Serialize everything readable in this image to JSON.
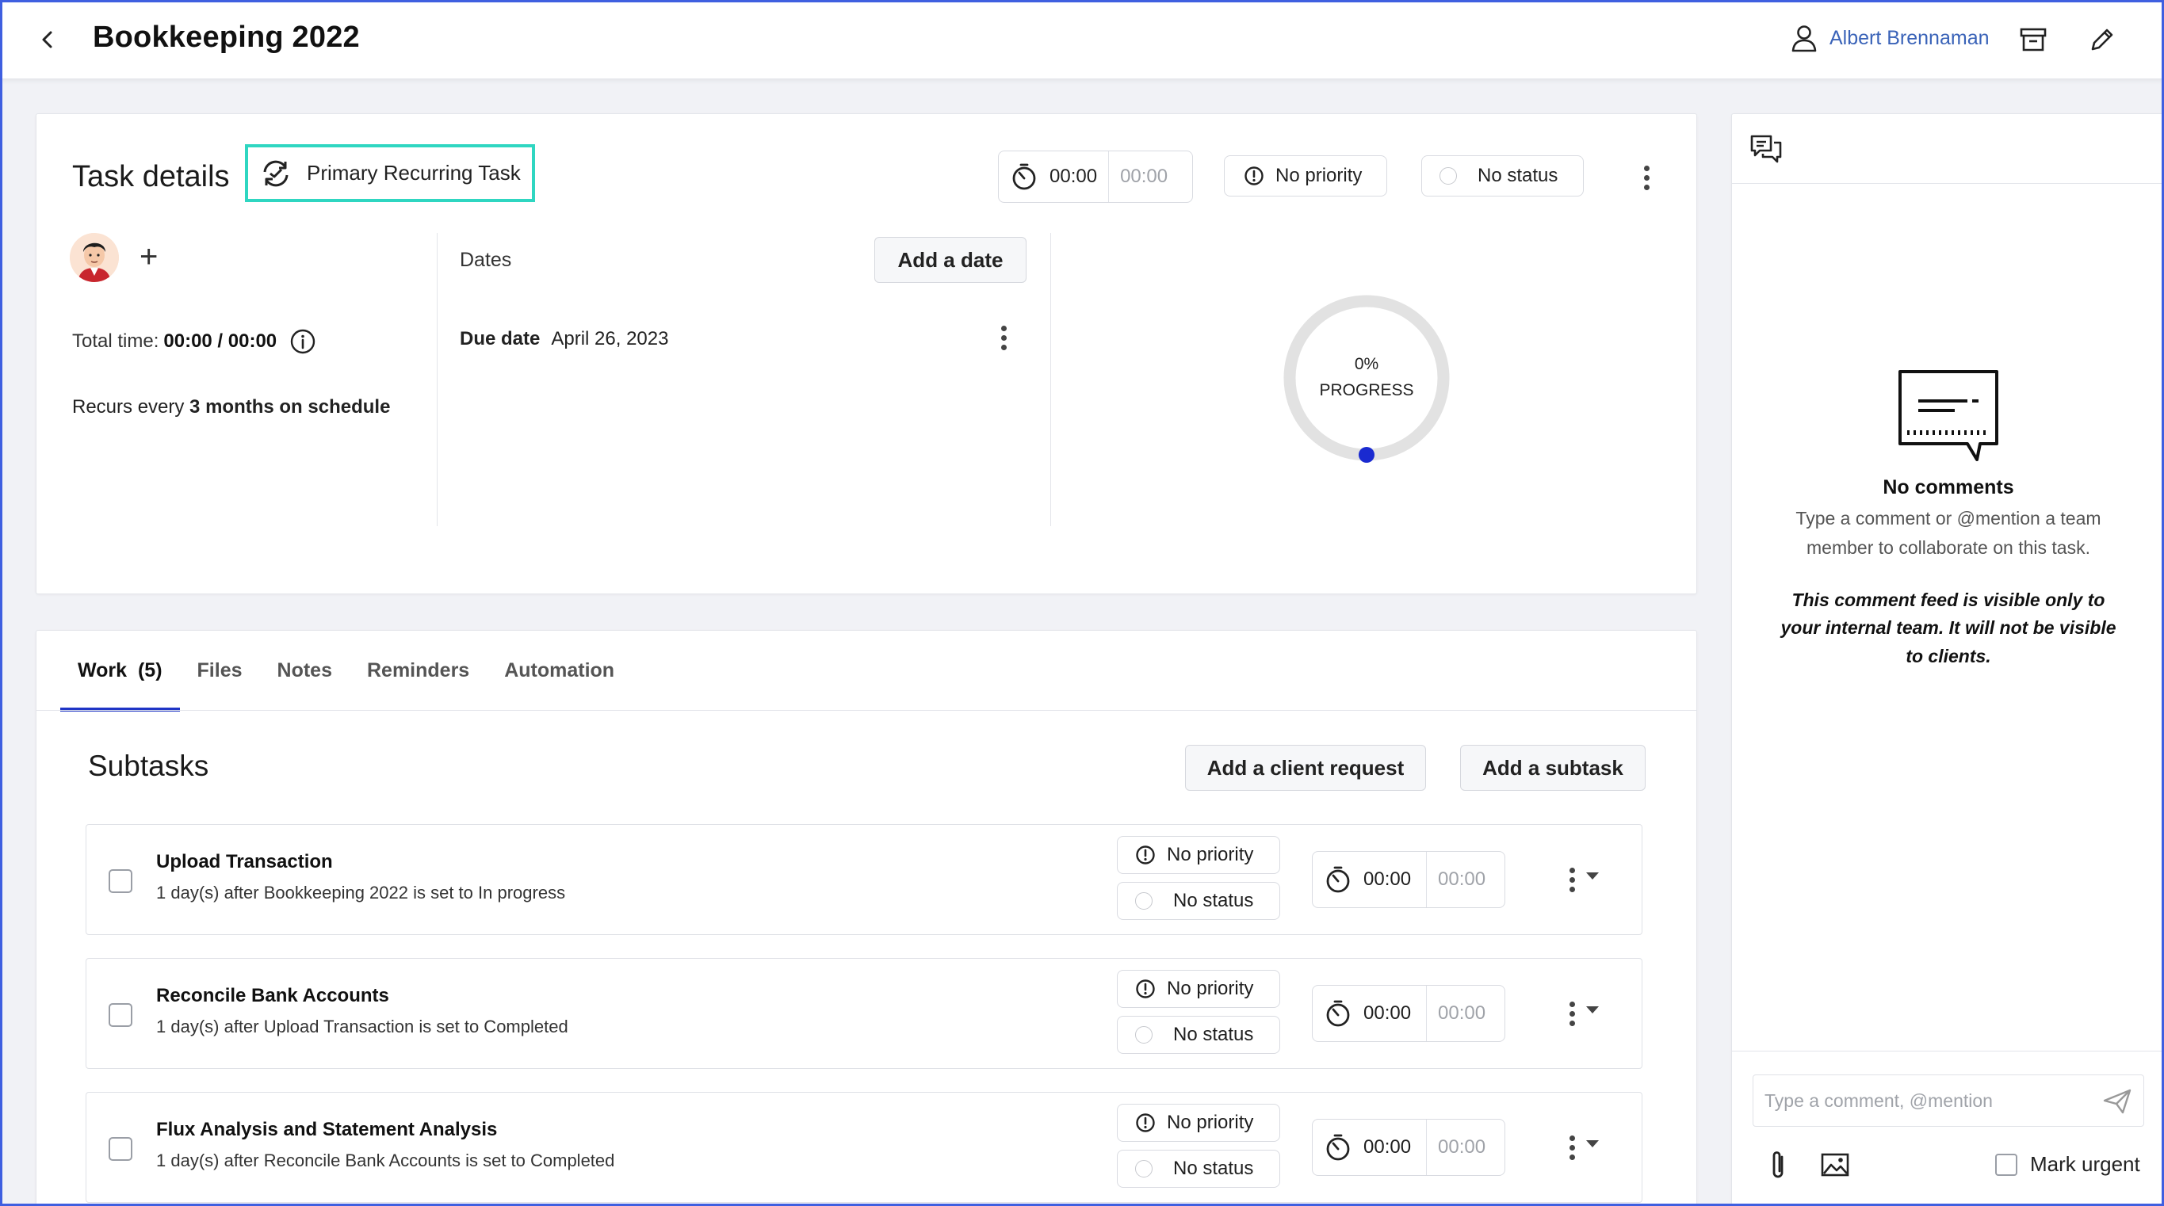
{
  "header": {
    "title": "Bookkeeping 2022",
    "user_name": "Albert Brennaman",
    "icons": {
      "back": "chevron-left-icon",
      "user": "user-icon",
      "archive": "archive-icon",
      "edit": "pencil-icon"
    }
  },
  "task": {
    "title": "Task details",
    "recurring_label": "Primary Recurring Task",
    "timer_elapsed": "00:00",
    "timer_budget": "00:00",
    "priority": "No priority",
    "status": "No status",
    "total_time_label": "Total time:",
    "total_time_value": "00:00 / 00:00",
    "recurs_prefix": "Recurs every",
    "recurs_value": "3 months on schedule",
    "dates_label": "Dates",
    "add_date_label": "Add a date",
    "due_label": "Due date",
    "due_value": "April 26, 2023",
    "progress_value": "0%",
    "progress_label": "PROGRESS",
    "progress_fraction": 0
  },
  "tabs": [
    {
      "label": "Work",
      "count": "(5)",
      "active": true
    },
    {
      "label": "Files"
    },
    {
      "label": "Notes"
    },
    {
      "label": "Reminders"
    },
    {
      "label": "Automation"
    }
  ],
  "subtasks": {
    "title": "Subtasks",
    "add_client_request_label": "Add a client request",
    "add_subtask_label": "Add a subtask",
    "items": [
      {
        "name": "Upload Transaction",
        "desc": "1 day(s) after Bookkeeping 2022 is set to In progress",
        "priority": "No priority",
        "status": "No status",
        "elapsed": "00:00",
        "budget": "00:00"
      },
      {
        "name": "Reconcile Bank Accounts",
        "desc": "1 day(s) after Upload Transaction is set to Completed",
        "priority": "No priority",
        "status": "No status",
        "elapsed": "00:00",
        "budget": "00:00"
      },
      {
        "name": "Flux Analysis and Statement Analysis",
        "desc": "1 day(s) after Reconcile Bank Accounts is set to Completed",
        "priority": "No priority",
        "status": "No status",
        "elapsed": "00:00",
        "budget": "00:00"
      }
    ]
  },
  "comments": {
    "empty_title": "No comments",
    "empty_desc": "Type a comment or @mention a team member to collaborate on this task.",
    "empty_note": "This comment feed is visible only to your internal team. It will not be visible to clients.",
    "input_placeholder": "Type a comment, @mention",
    "mark_urgent_label": "Mark urgent"
  },
  "colors": {
    "accent": "#1f35c6",
    "recurring_border": "#2fd6c1",
    "user_link": "#3a63b8",
    "progress_dot": "#1a2ad0"
  }
}
